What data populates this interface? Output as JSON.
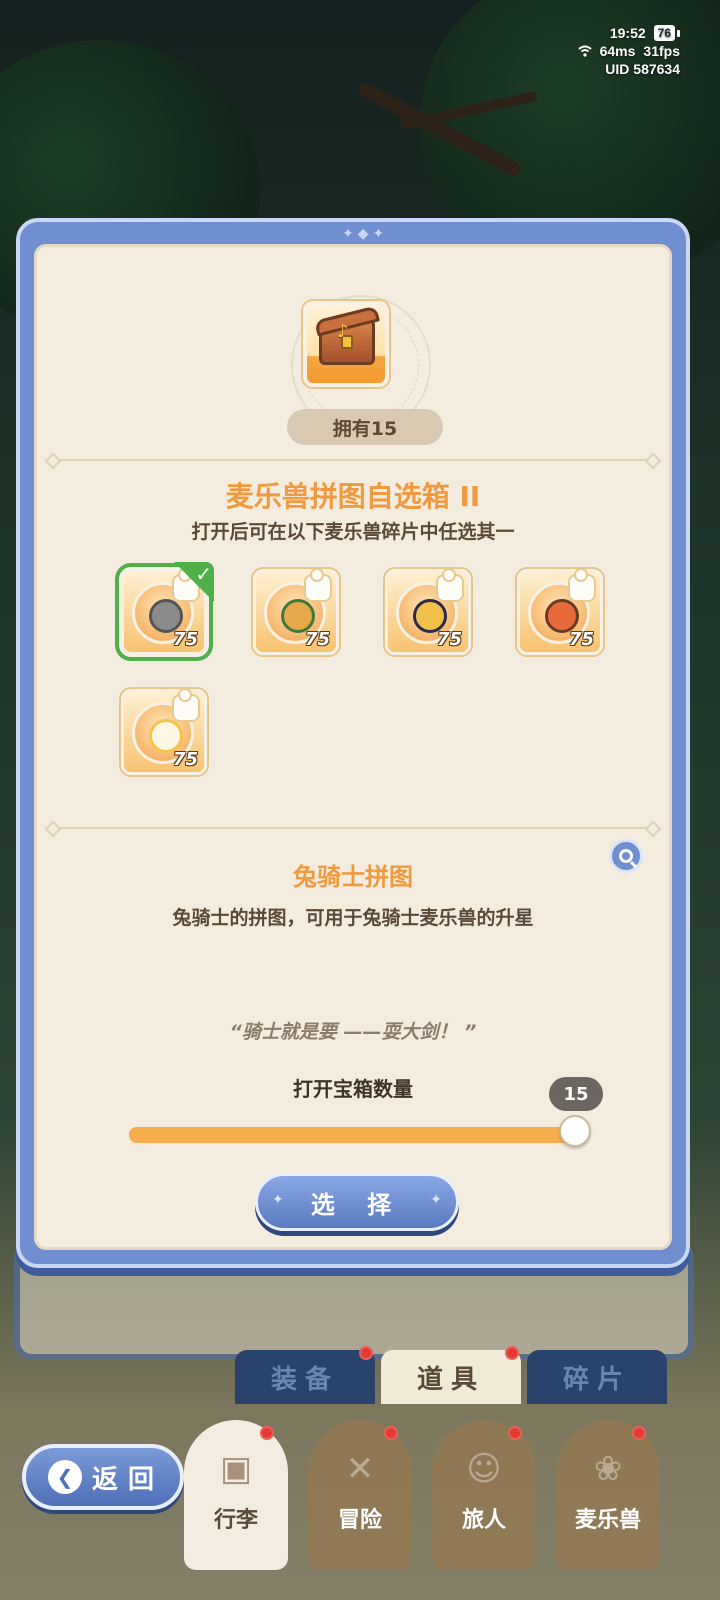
{
  "status_bar": {
    "time": "19:52",
    "battery": "76",
    "ping": "64ms",
    "fps": "31fps",
    "uid": "UID 587634"
  },
  "dialog": {
    "owned_label": "拥有15",
    "box_title": "麦乐兽拼图自选箱 II",
    "box_description": "打开后可在以下麦乐兽碎片中任选其一",
    "pieces": [
      {
        "count": "75",
        "selected": true
      },
      {
        "count": "75",
        "selected": false
      },
      {
        "count": "75",
        "selected": false
      },
      {
        "count": "75",
        "selected": false
      },
      {
        "count": "75",
        "selected": false
      }
    ],
    "fragment_title": "兔骑士拼图",
    "fragment_description": "兔骑士的拼图，可用于兔骑士麦乐兽的升星",
    "quote": "“骑士就是要 ——耍大剑！ ”",
    "quantity_label": "打开宝箱数量",
    "quantity_value": "15",
    "quantity_fraction": 1.0,
    "select_button": "选 择"
  },
  "sub_tabs": [
    "装备",
    "道具",
    "碎片"
  ],
  "bottom_nav": [
    "行李",
    "冒险",
    "旅人",
    "麦乐兽"
  ],
  "back_button": "返回",
  "colors": {
    "accent_orange": "#ef9a3e",
    "frame_blue": "#6f8fd0",
    "selected_green": "#4fb04a",
    "parchment": "#f3ecdf"
  }
}
